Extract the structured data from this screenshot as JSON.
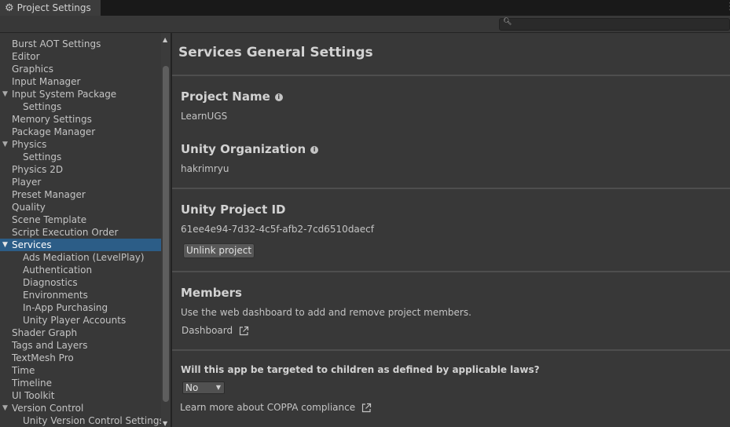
{
  "window": {
    "tab_title": "Project Settings",
    "tab_icon": "gear-icon"
  },
  "search": {
    "placeholder": ""
  },
  "sidebar": {
    "items": [
      {
        "label": "Burst AOT Settings",
        "level": 0,
        "expandable": false
      },
      {
        "label": "Editor",
        "level": 0,
        "expandable": false
      },
      {
        "label": "Graphics",
        "level": 0,
        "expandable": false
      },
      {
        "label": "Input Manager",
        "level": 0,
        "expandable": false
      },
      {
        "label": "Input System Package",
        "level": 0,
        "expandable": true
      },
      {
        "label": "Settings",
        "level": 1,
        "expandable": false
      },
      {
        "label": "Memory Settings",
        "level": 0,
        "expandable": false
      },
      {
        "label": "Package Manager",
        "level": 0,
        "expandable": false
      },
      {
        "label": "Physics",
        "level": 0,
        "expandable": true
      },
      {
        "label": "Settings",
        "level": 1,
        "expandable": false
      },
      {
        "label": "Physics 2D",
        "level": 0,
        "expandable": false
      },
      {
        "label": "Player",
        "level": 0,
        "expandable": false
      },
      {
        "label": "Preset Manager",
        "level": 0,
        "expandable": false
      },
      {
        "label": "Quality",
        "level": 0,
        "expandable": false
      },
      {
        "label": "Scene Template",
        "level": 0,
        "expandable": false
      },
      {
        "label": "Script Execution Order",
        "level": 0,
        "expandable": false
      },
      {
        "label": "Services",
        "level": 0,
        "expandable": true,
        "selected": true
      },
      {
        "label": "Ads Mediation (LevelPlay)",
        "level": 1,
        "expandable": false
      },
      {
        "label": "Authentication",
        "level": 1,
        "expandable": false
      },
      {
        "label": "Diagnostics",
        "level": 1,
        "expandable": false
      },
      {
        "label": "Environments",
        "level": 1,
        "expandable": false
      },
      {
        "label": "In-App Purchasing",
        "level": 1,
        "expandable": false
      },
      {
        "label": "Unity Player Accounts",
        "level": 1,
        "expandable": false
      },
      {
        "label": "Shader Graph",
        "level": 0,
        "expandable": false
      },
      {
        "label": "Tags and Layers",
        "level": 0,
        "expandable": false
      },
      {
        "label": "TextMesh Pro",
        "level": 0,
        "expandable": false
      },
      {
        "label": "Time",
        "level": 0,
        "expandable": false
      },
      {
        "label": "Timeline",
        "level": 0,
        "expandable": false
      },
      {
        "label": "UI Toolkit",
        "level": 0,
        "expandable": false
      },
      {
        "label": "Version Control",
        "level": 0,
        "expandable": true
      },
      {
        "label": "Unity Version Control Settings",
        "level": 1,
        "expandable": false
      }
    ]
  },
  "main": {
    "title": "Services General Settings",
    "project_name": {
      "label": "Project Name",
      "value": "LearnUGS"
    },
    "organization": {
      "label": "Unity Organization",
      "value": "hakrimryu"
    },
    "project_id": {
      "label": "Unity Project ID",
      "value": "61ee4e94-7d32-4c5f-afb2-7cd6510daecf",
      "unlink_label": "Unlink project"
    },
    "members": {
      "label": "Members",
      "description": "Use the web dashboard to add and remove project members.",
      "dashboard_link": "Dashboard"
    },
    "coppa": {
      "question": "Will this app be targeted to children as defined by applicable laws?",
      "selected": "No",
      "learn_more": "Learn more about COPPA compliance"
    }
  },
  "colors": {
    "background": "#383838",
    "selected": "#2c5d87",
    "titlebar": "#191919",
    "text": "#c4c4c4"
  }
}
